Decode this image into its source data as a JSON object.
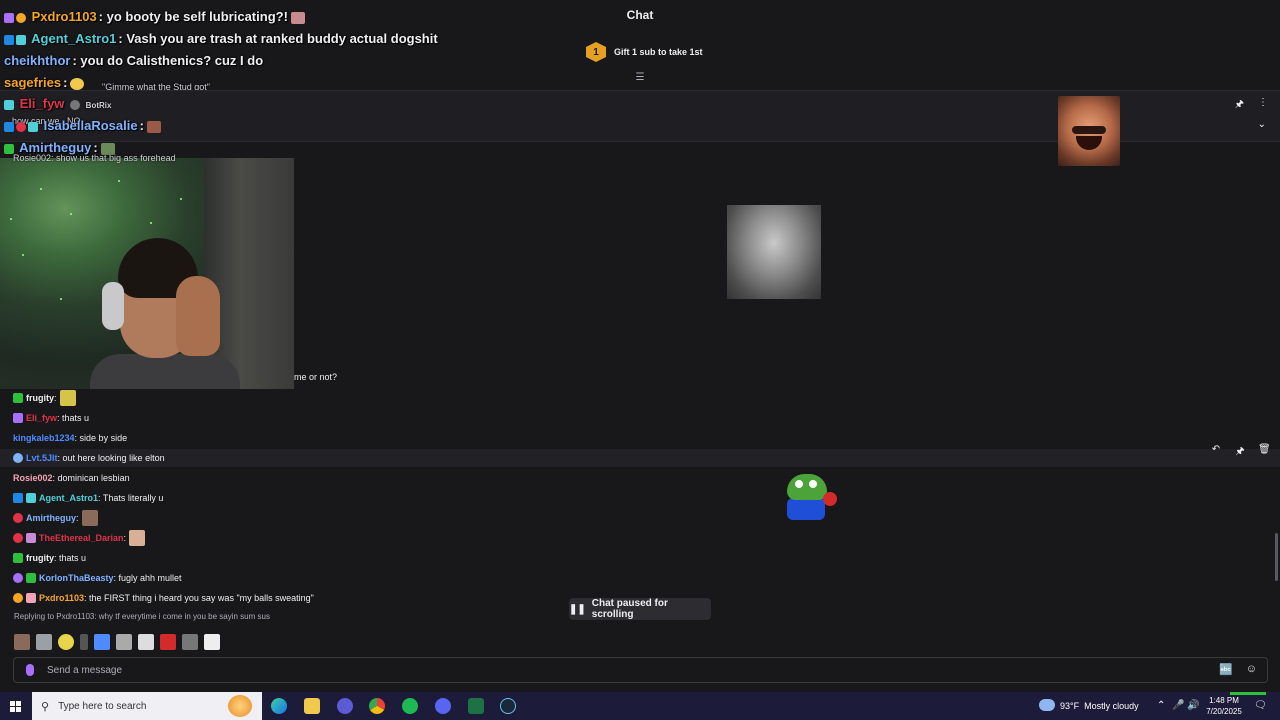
{
  "overlay": {
    "lines": [
      {
        "user": "Pxdro1103",
        "user_color": "#f5a623",
        "text": ": yo booty be self lubricating?!"
      },
      {
        "user": "Agent_Astro1",
        "user_color": "#4fd0d8",
        "text": ": Vash you are trash at ranked buddy actual dogshit"
      },
      {
        "user": "cheikhthor",
        "user_color": "#7fb2ff",
        "text": ": you do Calisthenics? cuz I do"
      },
      {
        "user": "sagefries",
        "user_color": "#f5a623",
        "text": ":"
      },
      {
        "user": "Eli_fyw",
        "user_color": "#e0334a",
        "text": ""
      },
      {
        "user": "IsabellaRosalie",
        "user_color": "#7fb2ff",
        "text": ":"
      },
      {
        "user": "Amirtheguy",
        "user_color": "#7fb2ff",
        "text": ":"
      }
    ],
    "small_texts": [
      "\"Gimme what the Stud got\"",
      "BotRix",
      "how can we...NO",
      "Rosie002: show us that big ass forehead"
    ]
  },
  "chat_header": {
    "title": "Chat",
    "gift_rank": "1",
    "gift_text": "Gift 1 sub to take 1st",
    "expand_icon": "list-expand-icon"
  },
  "pinned": {
    "icons": [
      "pin-icon",
      "more-vertical-icon"
    ],
    "chevron": "chevron-down-icon"
  },
  "cutoff_text": "me or not?",
  "chat_messages": [
    {
      "user": "frugity",
      "user_color": "#efeff1",
      "text": "",
      "badge": "#2fbf3f"
    },
    {
      "user": "Eli_fyw",
      "user_color": "#e0334a",
      "text": ": thats u",
      "badge": "#a970ff"
    },
    {
      "user": "kingkaleb1234",
      "user_color": "#4f8bff",
      "text": ": side by side",
      "badge": ""
    },
    {
      "user": "Lvt.5Jlt",
      "user_color": "#4f8bff",
      "text": ": out here looking like elton",
      "badge": "#7fb2ff"
    },
    {
      "user": "Rosie002",
      "user_color": "#f5a3b6",
      "text": ": dominican lesbian",
      "badge": ""
    },
    {
      "user": "Agent_Astro1",
      "user_color": "#4fd0d8",
      "text": ": Thats literally u",
      "badge": "#1e88e5"
    },
    {
      "user": "Amirtheguy",
      "user_color": "#7fb2ff",
      "text": ":",
      "badge": "#e0334a"
    },
    {
      "user": "TheEthereal_Darian",
      "user_color": "#e0334a",
      "text": ":",
      "badge": "#e0334a"
    },
    {
      "user": "frugity",
      "user_color": "#efeff1",
      "text": ": thats u",
      "badge": "#2fbf3f"
    },
    {
      "user": "KorlonThaBeasty",
      "user_color": "#7fb2ff",
      "text": ": fugly ahh mullet",
      "badge": "#a970ff"
    },
    {
      "user": "Pxdro1103",
      "user_color": "#f5a623",
      "text": ": the FIRST thing i heard you say was \"my balls sweating\"",
      "badge": "#f5a623"
    }
  ],
  "row_actions": [
    "reply-icon",
    "pin-icon",
    "delete-icon"
  ],
  "reply_preview": "Replying to Pxdro1103: why tf everytime i come in you be sayin sum sus",
  "paused_label": "Chat paused for scrolling",
  "chat_input": {
    "placeholder": "Send a message",
    "icons": [
      "translate-icon",
      "emote-picker-icon"
    ]
  },
  "taskbar": {
    "search_placeholder": "Type here to search",
    "apps": [
      "edge-icon",
      "file-explorer-icon",
      "vpn-icon",
      "chrome-icon",
      "spotify-icon",
      "discord-icon",
      "excel-icon",
      "steam-icon"
    ],
    "weather_temp": "93°F",
    "weather_text": "Mostly cloudy",
    "time": "1:48 PM",
    "date": "7/20/2025"
  },
  "colors": {
    "background": "#18181b",
    "accent_purple": "#a970ff",
    "taskbar": "#1c1c3a"
  }
}
